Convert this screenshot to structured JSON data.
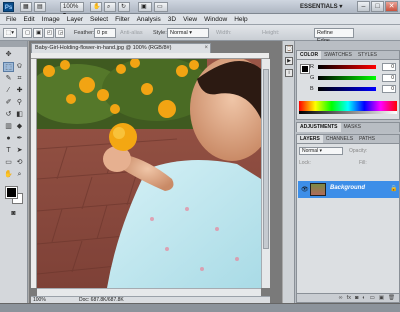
{
  "app": {
    "logo": "Ps",
    "zoom": "100%",
    "workspace": "ESSENTIALS"
  },
  "menu": [
    "File",
    "Edit",
    "Image",
    "Layer",
    "Select",
    "Filter",
    "Analysis",
    "3D",
    "View",
    "Window",
    "Help"
  ],
  "options": {
    "feather_label": "Feather:",
    "feather_value": "0 px",
    "antialias_label": "Anti-alias",
    "style_label": "Style:",
    "style_value": "Normal",
    "width_label": "Width:",
    "height_label": "Height:",
    "refine_edge": "Refine Edge..."
  },
  "document": {
    "tab_title": "Baby-Girl-Holding-flower-in-hand.jpg @ 100% (RGB/8#)",
    "status_zoom": "100%",
    "status_doc": "Doc: 687.8K/687.8K"
  },
  "color_panel": {
    "tabs": [
      "COLOR",
      "SWATCHES",
      "STYLES"
    ],
    "channels": [
      {
        "name": "R",
        "value": "0",
        "gradient": "linear-gradient(90deg,#000,#f00)"
      },
      {
        "name": "G",
        "value": "0",
        "gradient": "linear-gradient(90deg,#000,#0f0)"
      },
      {
        "name": "B",
        "value": "0",
        "gradient": "linear-gradient(90deg,#000,#00f)"
      }
    ]
  },
  "adjustments_panel": {
    "tabs": [
      "ADJUSTMENTS",
      "MASKS"
    ]
  },
  "layers_panel": {
    "tabs": [
      "LAYERS",
      "CHANNELS",
      "PATHS"
    ],
    "blend_mode": "Normal",
    "opacity_label": "Opacity:",
    "lock_label": "Lock:",
    "fill_label": "Fill:",
    "layer_name": "Background"
  },
  "colors": {
    "layer_selected": "#3d8ee8",
    "foreground": "#000000",
    "background": "#ffffff"
  }
}
